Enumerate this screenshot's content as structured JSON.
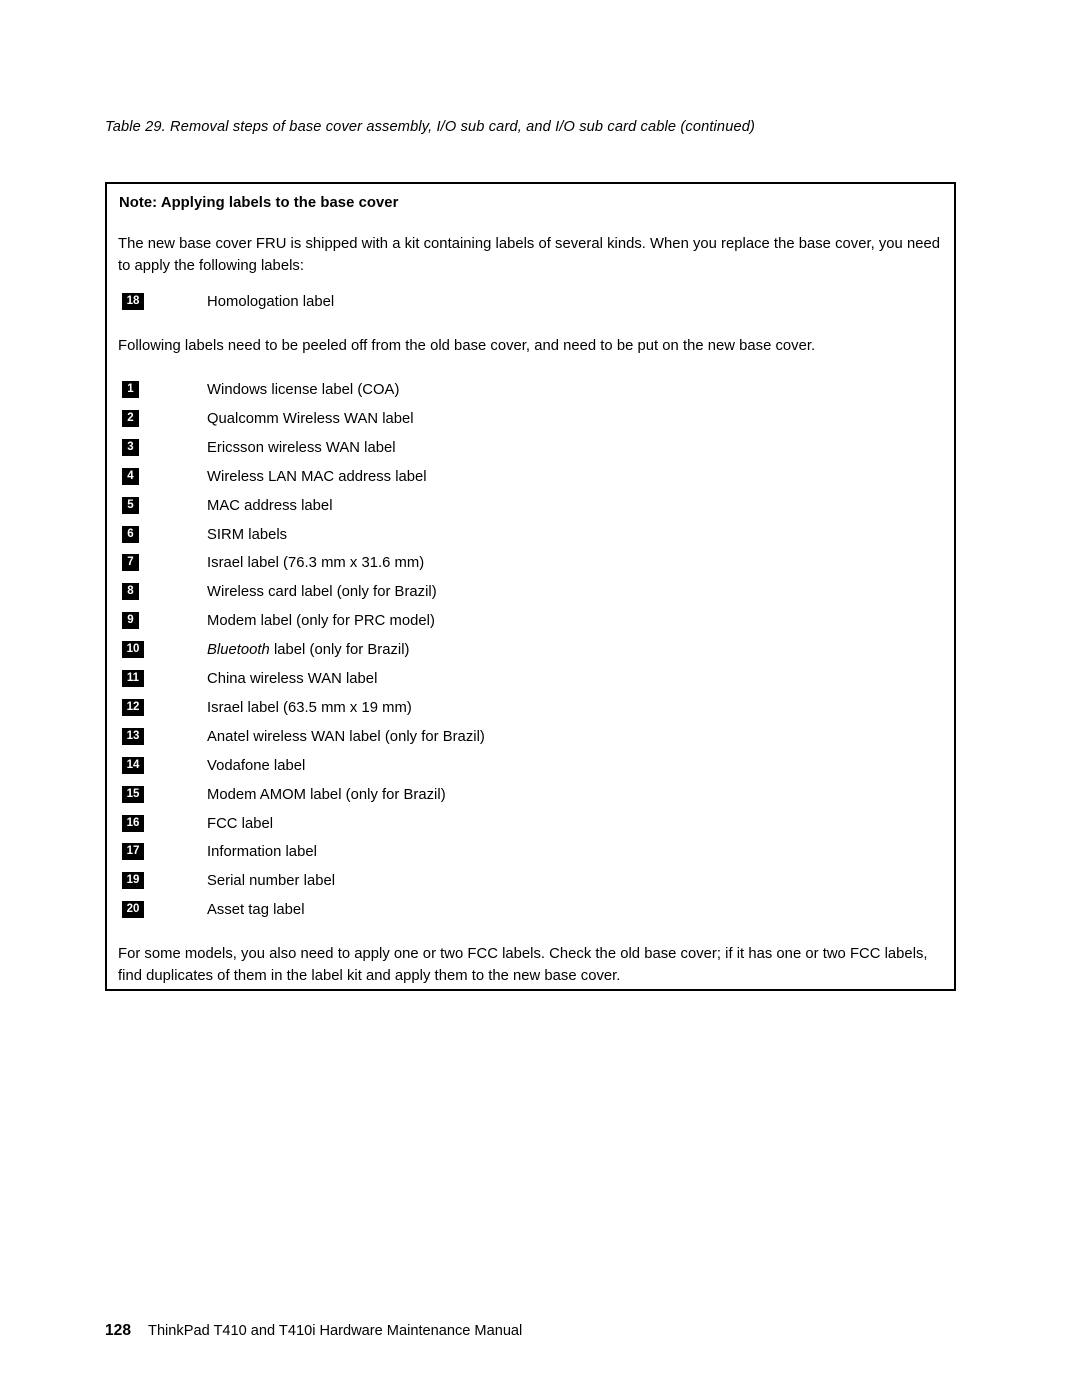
{
  "document": {
    "table_caption": "Table 29. Removal steps of base cover assembly, I/O sub card, and I/O sub card cable (continued)",
    "note": {
      "heading": "Note: Applying labels to the base cover",
      "intro_paragraph": "The new base cover FRU is shipped with a kit containing labels of several kinds. When you replace the base cover, you need to apply the following labels:",
      "first_group": [
        {
          "number": "18",
          "label": "Homologation label"
        }
      ],
      "following_paragraph": "Following labels need to be peeled off from the old base cover, and need to be put on the new base cover.",
      "peel_off_group": [
        {
          "number": "1",
          "label": "Windows license label (COA)"
        },
        {
          "number": "2",
          "label": "Qualcomm Wireless WAN label"
        },
        {
          "number": "3",
          "label": "Ericsson wireless WAN label"
        },
        {
          "number": "4",
          "label": "Wireless LAN MAC address label"
        },
        {
          "number": "5",
          "label": "MAC address label"
        },
        {
          "number": "6",
          "label": "SIRM labels"
        },
        {
          "number": "7",
          "label": "Israel label (76.3 mm x 31.6 mm)"
        },
        {
          "number": "8",
          "label": "Wireless card label (only for Brazil)"
        },
        {
          "number": "9",
          "label": "Modem label (only for PRC model)"
        },
        {
          "number": "10",
          "label_italic_prefix": "Bluetooth",
          "label_rest": " label (only for Brazil)"
        },
        {
          "number": "11",
          "label": "China wireless WAN label"
        },
        {
          "number": "12",
          "label": "Israel label (63.5 mm x 19 mm)"
        },
        {
          "number": "13",
          "label": "Anatel wireless WAN label (only for Brazil)"
        },
        {
          "number": "14",
          "label": "Vodafone label"
        },
        {
          "number": "15",
          "label": "Modem AMOM label (only for Brazil)"
        },
        {
          "number": "16",
          "label": "FCC label"
        },
        {
          "number": "17",
          "label": "Information label"
        },
        {
          "number": "19",
          "label": "Serial number label"
        },
        {
          "number": "20",
          "label": "Asset tag label"
        }
      ],
      "closing_paragraph": "For some models, you also need to apply one or two FCC labels. Check the old base cover; if it has one or two FCC labels, find duplicates of them in the label kit and apply them to the new base cover."
    },
    "footer": {
      "page_number": "128",
      "manual_title": "ThinkPad T410 and T410i Hardware Maintenance Manual"
    },
    "colors": {
      "text": "#000000",
      "badge_background": "#000000",
      "badge_text": "#ffffff",
      "box_border": "#000000",
      "page_background": "#ffffff"
    }
  }
}
